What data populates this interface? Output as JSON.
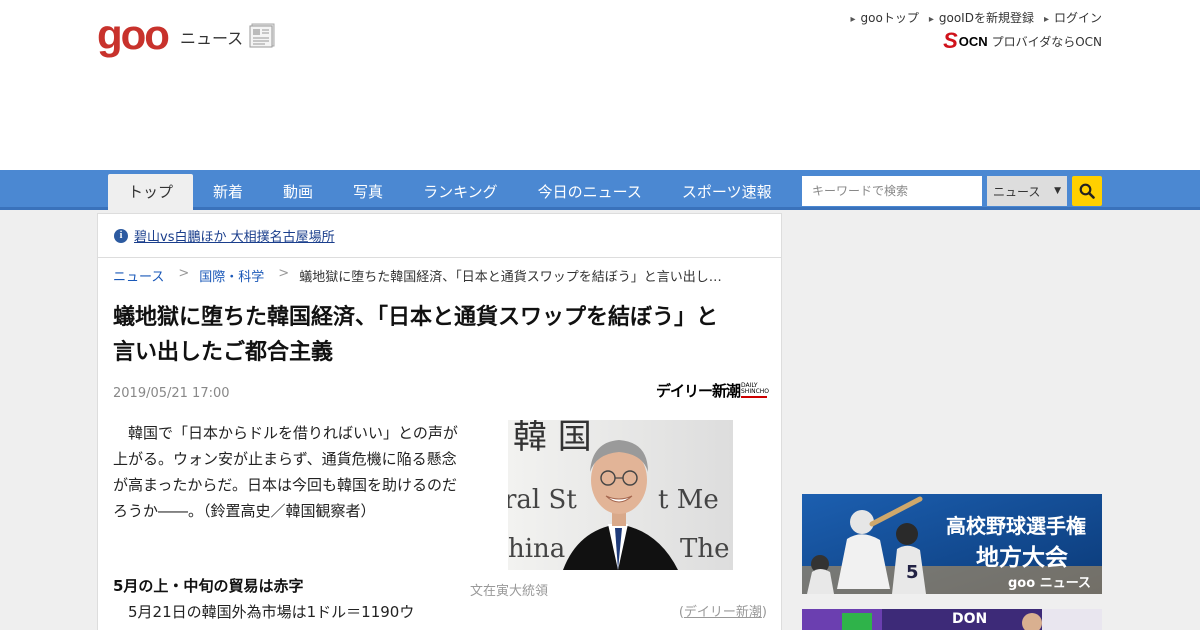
{
  "header": {
    "logo_text": "goo",
    "section": "ニュース",
    "top_links": [
      "gooトップ",
      "gooIDを新規登録",
      "ログイン"
    ],
    "ocn_logo": "OCN",
    "ocn_text": "プロバイダならOCN"
  },
  "nav": {
    "tabs": [
      "トップ",
      "新着",
      "動画",
      "写真",
      "ランキング",
      "今日のニュース",
      "スポーツ速報"
    ],
    "active_tab": "トップ",
    "search_placeholder": "キーワードで検索",
    "search_scope": "ニュース"
  },
  "notice": {
    "text": "碧山vs白鵬ほか 大相撲名古屋場所"
  },
  "breadcrumb": [
    "ニュース",
    "国際・科学",
    "蟻地獄に堕ちた韓国経済、「日本と通貨スワップを結ぼう」と言い出し…"
  ],
  "article": {
    "title": "蟻地獄に堕ちた韓国経済、「日本と通貨スワップを結ぼう」と言い出したご都合主義",
    "date": "2019/05/21 17:00",
    "source_logo": "デイリー新潮",
    "source_logo_small": "DAILY SHINCHO",
    "lead": "韓国で「日本からドルを借りればいい」との声が上がる。ウォン安が止まらず、通貨危機に陥る懸念が高まったからだ。日本は今回も韓国を助けるのだろうか――。（鈴置高史／韓国観察者）",
    "photo_caption": "文在寅大統領",
    "credit_open": "(",
    "credit_source": "デイリー新潮",
    "credit_close": ")",
    "subhead": "5月の上・中旬の貿易は赤字",
    "body_start": "5月21日の韓国外為市場は1ドル＝1190ウ"
  },
  "sidebar": {
    "banner1_title1": "高校野球選手権",
    "banner1_title2": "地方大会",
    "banner1_brand": "goo ニュース",
    "banner2_text": "DON"
  },
  "colors": {
    "goo_red": "#c8322c",
    "nav_blue": "#4b88d2",
    "search_yellow": "#ffd000",
    "link_blue": "#1a58b8"
  }
}
